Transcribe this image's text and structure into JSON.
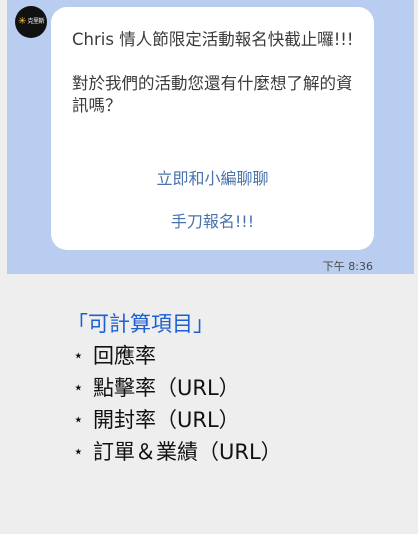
{
  "chat": {
    "avatar_icon": "brand-logo",
    "avatar_logo_text": "克里斯",
    "message": "Chris 情人節限定活動報名快截止囉!!!\n\n對於我們的活動您還有什麼想了解的資訊嗎？",
    "actions": [
      {
        "label": "立即和小編聊聊"
      },
      {
        "label": "手刀報名!!!"
      }
    ],
    "timestamp": "下午 8:36"
  },
  "calc": {
    "title": "「可計算項目」",
    "bullet": "⋆",
    "items": [
      {
        "label": "回應率"
      },
      {
        "label": "點擊率（URL）"
      },
      {
        "label": "開封率（URL）"
      },
      {
        "label": "訂單＆業績（URL）"
      }
    ]
  },
  "colors": {
    "chat_background": "#b8cdef",
    "bubble": "#ffffff",
    "action_link": "#4a73aa",
    "calc_title": "#1a5fd4"
  }
}
